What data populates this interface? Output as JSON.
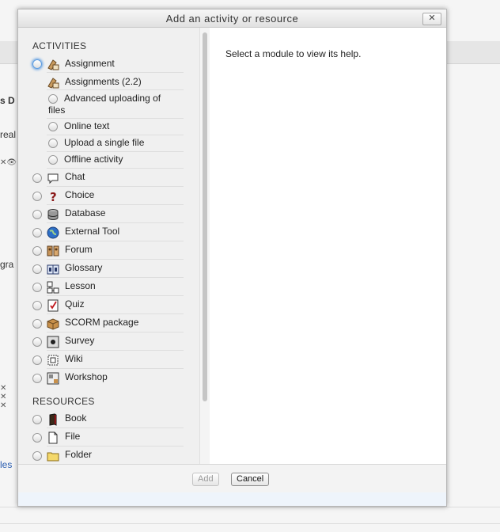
{
  "dialog": {
    "title": "Add an activity or resource",
    "close_label": "✕",
    "help_text": "Select a module to view its help.",
    "add_label": "Add",
    "cancel_label": "Cancel"
  },
  "activities": {
    "heading": "ACTIVITIES",
    "items": [
      {
        "label": "Assignment",
        "icon": "assignment-icon"
      },
      {
        "label": "Assignments (2.2)",
        "icon": "assignment-icon"
      },
      {
        "label": "Advanced uploading of files",
        "icon": ""
      },
      {
        "label": "Online text",
        "icon": ""
      },
      {
        "label": "Upload a single file",
        "icon": ""
      },
      {
        "label": "Offline activity",
        "icon": ""
      },
      {
        "label": "Chat",
        "icon": "chat-icon"
      },
      {
        "label": "Choice",
        "icon": "choice-icon"
      },
      {
        "label": "Database",
        "icon": "database-icon"
      },
      {
        "label": "External Tool",
        "icon": "external-tool-icon"
      },
      {
        "label": "Forum",
        "icon": "forum-icon"
      },
      {
        "label": "Glossary",
        "icon": "glossary-icon"
      },
      {
        "label": "Lesson",
        "icon": "lesson-icon"
      },
      {
        "label": "Quiz",
        "icon": "quiz-icon"
      },
      {
        "label": "SCORM package",
        "icon": "scorm-icon"
      },
      {
        "label": "Survey",
        "icon": "survey-icon"
      },
      {
        "label": "Wiki",
        "icon": "wiki-icon"
      },
      {
        "label": "Workshop",
        "icon": "workshop-icon"
      }
    ]
  },
  "resources": {
    "heading": "RESOURCES",
    "items": [
      {
        "label": "Book",
        "icon": "book-icon"
      },
      {
        "label": "File",
        "icon": "file-icon"
      },
      {
        "label": "Folder",
        "icon": "folder-icon"
      }
    ]
  },
  "background": {
    "frag1": "s D",
    "frag2": "real",
    "frag3": "gra",
    "frag4": "les"
  }
}
